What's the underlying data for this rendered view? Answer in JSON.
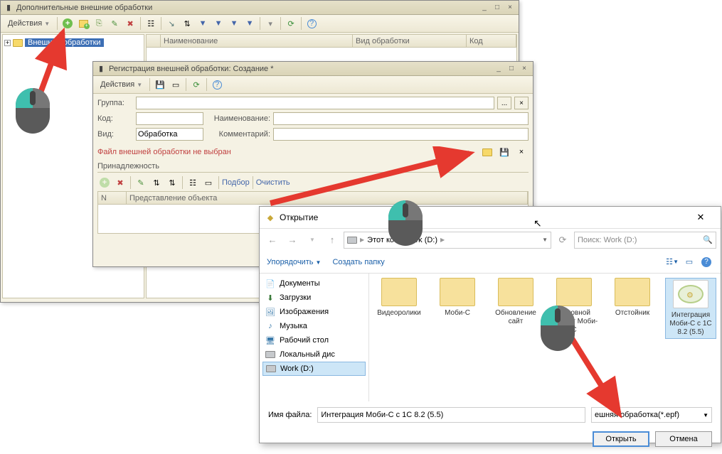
{
  "win1": {
    "title": "Дополнительные внешние обработки",
    "actions": "Действия",
    "tree_root": "Внешние обработки",
    "grid": {
      "col1": "Наименование",
      "col2": "Вид обработки",
      "col3": "Код"
    },
    "col_blank": ""
  },
  "win2": {
    "title": "Регистрация внешней обработки: Создание *",
    "actions": "Действия",
    "labels": {
      "group": "Группа:",
      "code": "Код:",
      "name": "Наименование:",
      "kind": "Вид:",
      "comment": "Комментарий:"
    },
    "kind_value": "Обработка",
    "warning": "Файл внешней обработки не выбран",
    "ownership": "Принадлежность",
    "subbar": {
      "select": "Подбор",
      "clear": "Очистить"
    },
    "grid": {
      "colN": "N",
      "colRep": "Представление объекта"
    }
  },
  "fdlg": {
    "title": "Открытие",
    "crumb_pc": "Этот ко",
    "crumb_wd": "Work (D:)",
    "search_ph": "Поиск: Work (D:)",
    "organize": "Упорядочить",
    "newfolder": "Создать папку",
    "side": {
      "docs": "Документы",
      "downloads": "Загрузки",
      "images": "Изображения",
      "music": "Музыка",
      "desktop": "Рабочий стол",
      "localdisk": "Локальный дис",
      "workd": "Work (D:)"
    },
    "files": {
      "f1": "Видеоролики",
      "f2": "Моби-С",
      "f3": "Обновление сайт",
      "f4": "Основной каталог Моби-С",
      "f5": "Отстойник",
      "f6": "Интеграция Моби-С с 1С 8.2 (5.5)"
    },
    "fname_label": "Имя файла:",
    "fname_value": "Интеграция Моби-С с 1С 8.2 (5.5)",
    "filter": "ешняя обработка(*.epf)",
    "open": "Открыть",
    "cancel": "Отмена"
  }
}
